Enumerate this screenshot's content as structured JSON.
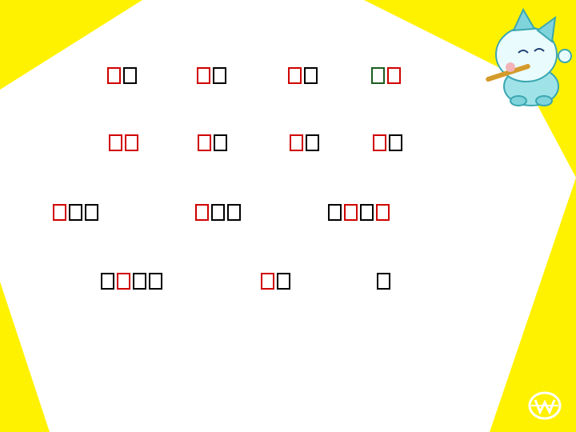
{
  "slide": {
    "background": "#ffffff",
    "frame_color": "#fff200"
  },
  "rows": [
    {
      "words": [
        {
          "glyphs": [
            "red",
            "black"
          ]
        },
        {
          "glyphs": [
            "red",
            "black"
          ]
        },
        {
          "glyphs": [
            "red",
            "black"
          ]
        },
        {
          "glyphs": [
            "green",
            "red"
          ]
        }
      ]
    },
    {
      "words": [
        {
          "glyphs": [
            "red",
            "red"
          ]
        },
        {
          "glyphs": [
            "red",
            "black"
          ]
        },
        {
          "glyphs": [
            "red",
            "black"
          ]
        },
        {
          "glyphs": [
            "red",
            "black"
          ]
        }
      ]
    },
    {
      "words": [
        {
          "glyphs": [
            "red",
            "black",
            "black"
          ]
        },
        {
          "glyphs": [
            "red",
            "black",
            "black"
          ]
        },
        {
          "glyphs": [
            "black",
            "red",
            "black",
            "red"
          ]
        }
      ]
    },
    {
      "words": [
        {
          "glyphs": [
            "black",
            "red",
            "black",
            "black"
          ]
        },
        {
          "glyphs": [
            "red",
            "black"
          ]
        },
        {
          "glyphs": [
            "black"
          ]
        }
      ]
    }
  ],
  "colors": {
    "red": "#d00000",
    "black": "#000000",
    "green": "#1b5e20"
  },
  "decorations": {
    "mascot_icon": "cartoon-horse-flute-icon",
    "logo_icon": "publisher-logo-icon"
  }
}
